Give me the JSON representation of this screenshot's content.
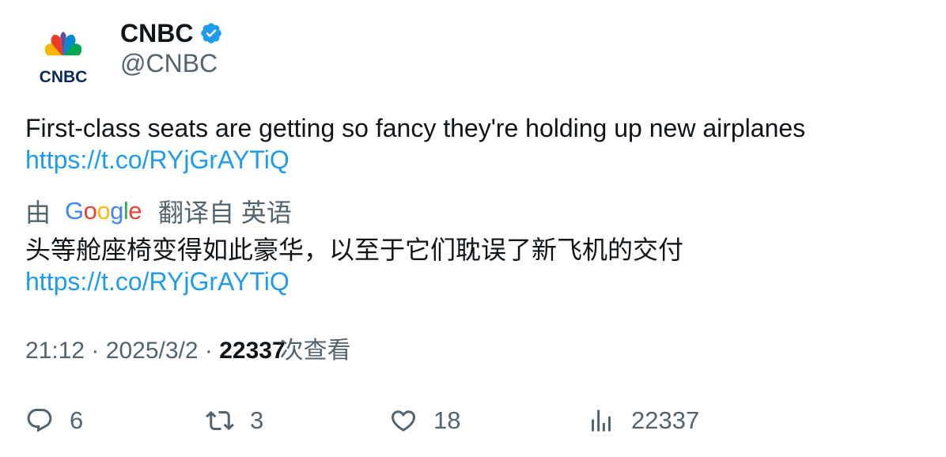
{
  "author": {
    "display_name": "CNBC",
    "handle": "@CNBC",
    "verified_icon": "verified-badge-icon",
    "avatar_text": "CNBC"
  },
  "tweet": {
    "text": "First-class seats are getting so fancy they're holding up new airplanes",
    "link": "https://t.co/RYjGrAYTiQ"
  },
  "translation": {
    "prefix": "由",
    "provider": "Google",
    "suffix": "翻译自 英语",
    "text": "头等舱座椅变得如此豪华，以至于它们耽误了新飞机的交付",
    "link": "https://t.co/RYjGrAYTiQ"
  },
  "meta": {
    "time": "21:12",
    "separator": "·",
    "date": "2025/3/2",
    "views": "22337",
    "views_label": "次查看"
  },
  "actions": {
    "replies": "6",
    "retweets": "3",
    "likes": "18",
    "views": "22337"
  },
  "colors": {
    "link": "#1d9bf0",
    "secondary": "#536471",
    "primary": "#0f1419",
    "verified": "#1d9bf0"
  }
}
